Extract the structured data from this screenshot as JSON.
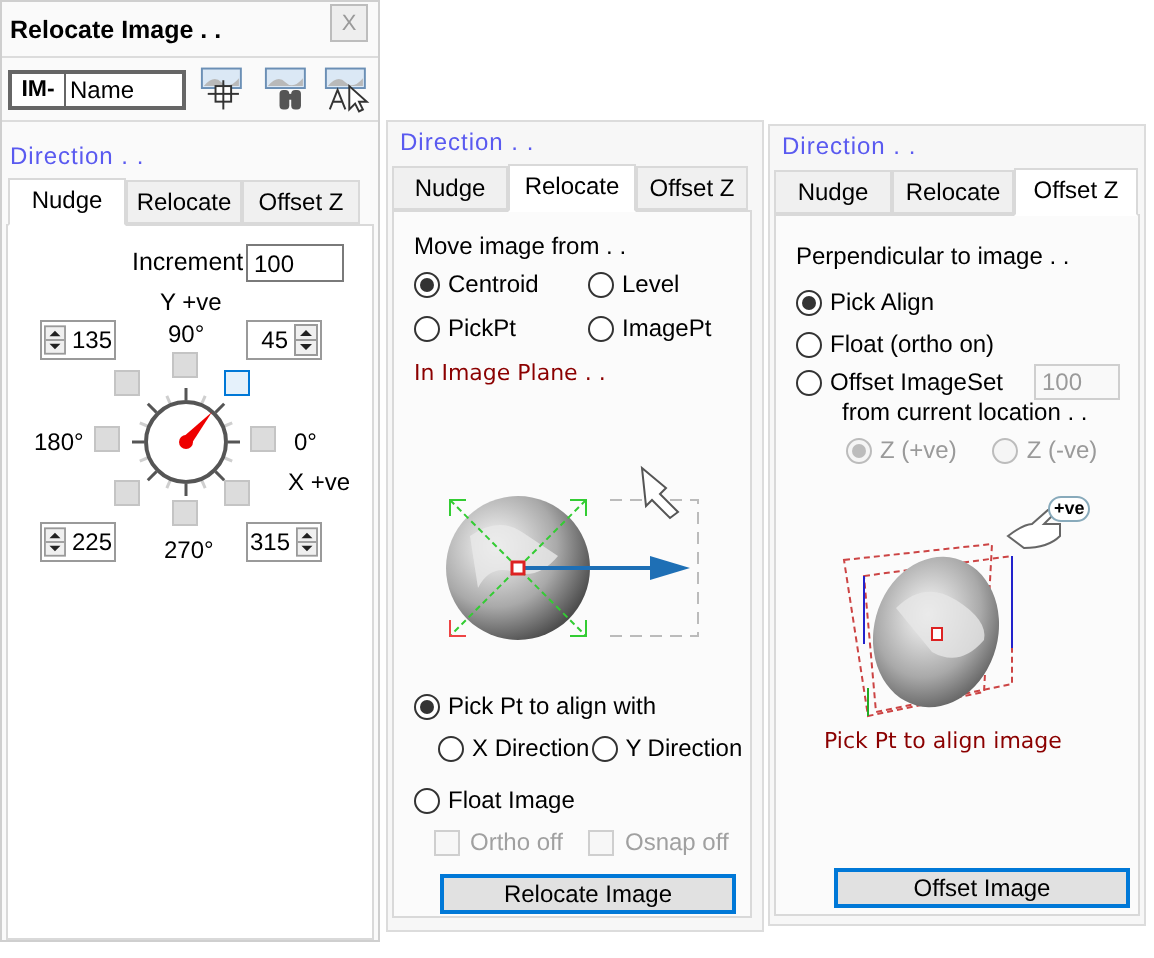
{
  "relocate_panel": {
    "title": "Relocate Image . .",
    "close_label": "X",
    "name_prefix": "IM-",
    "name_value": "Name",
    "section_label": "Direction . .",
    "tabs": [
      {
        "label": "Nudge",
        "selected": true
      },
      {
        "label": "Relocate",
        "selected": false
      },
      {
        "label": "Offset Z",
        "selected": false
      }
    ],
    "increment_label": "Increment",
    "increment_value": "100",
    "y_axis_label": "Y +ve",
    "x_axis_label": "X +ve",
    "angle_labels": [
      "90°",
      "180°",
      "0°",
      "270°"
    ],
    "spinners": [
      "135",
      "45",
      "225",
      "315"
    ],
    "direction_buttons": [
      {
        "selected": false
      },
      {
        "selected": true
      },
      {
        "selected": false
      },
      {
        "selected": false
      },
      {
        "selected": false
      },
      {
        "selected": false
      },
      {
        "selected": false
      },
      {
        "selected": false
      }
    ]
  },
  "relocate_tab_panel": {
    "section_label": "Direction . .",
    "tabs": [
      {
        "label": "Nudge",
        "selected": false
      },
      {
        "label": "Relocate",
        "selected": true
      },
      {
        "label": "Offset Z",
        "selected": false
      }
    ],
    "move_from_label": "Move image from . .",
    "move_from_options": [
      {
        "label": "Centroid",
        "selected": true
      },
      {
        "label": "Level",
        "selected": false
      },
      {
        "label": "PickPt",
        "selected": false
      },
      {
        "label": "ImagePt",
        "selected": false
      }
    ],
    "plane_label": "In Image Plane . .",
    "pick_option": {
      "label": "Pick Pt to align with",
      "selected": true
    },
    "direction_options": [
      {
        "label": "X Direction",
        "selected": false
      },
      {
        "label": "Y Direction",
        "selected": false
      }
    ],
    "float_option": {
      "label": "Float Image",
      "selected": false
    },
    "checkboxes": [
      {
        "label": "Ortho off",
        "checked": false,
        "disabled": true
      },
      {
        "label": "Osnap off",
        "checked": false,
        "disabled": true
      }
    ],
    "button": "Relocate Image"
  },
  "offset_tab_panel": {
    "section_label": "Direction . .",
    "tabs": [
      {
        "label": "Nudge",
        "selected": false
      },
      {
        "label": "Relocate",
        "selected": false
      },
      {
        "label": "Offset Z",
        "selected": true
      }
    ],
    "perpendicular_label": "Perpendicular to image . .",
    "options": [
      {
        "label": "Pick Align",
        "selected": true
      },
      {
        "label": "Float (ortho on)",
        "selected": false
      },
      {
        "label": "Offset ImageSet",
        "selected": false
      }
    ],
    "offset_value": "100",
    "location_label": "from current location . .",
    "z_options": [
      {
        "label": "Z (+ve)",
        "selected": true,
        "disabled": true
      },
      {
        "label": "Z (-ve)",
        "selected": false,
        "disabled": true
      }
    ],
    "badge": "+ve",
    "caption": "Pick Pt to align image",
    "button": "Offset Image"
  }
}
